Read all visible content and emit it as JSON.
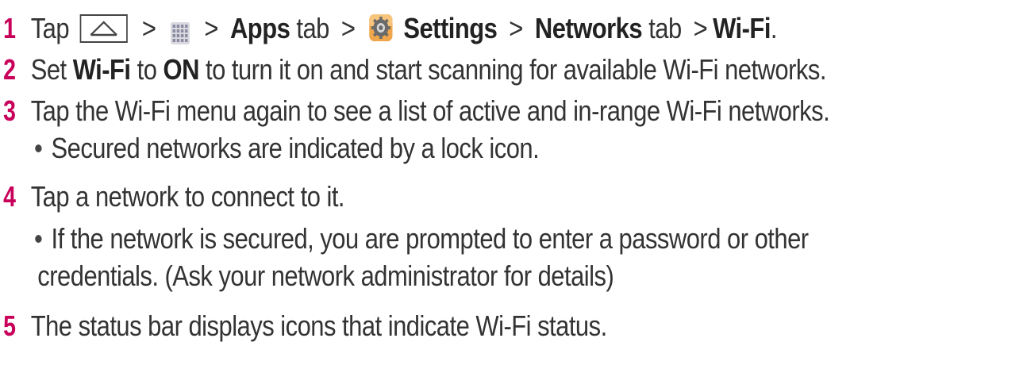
{
  "steps": [
    {
      "number": "1",
      "parts": {
        "tap": "Tap",
        "gt1": ">",
        "gt2": ">",
        "apps": "Apps",
        "tab1": "tab",
        "gt3": ">",
        "settings": "Settings",
        "gt4": ">",
        "networks": "Networks",
        "tab2": "tab",
        "gt5": ">",
        "wifi": "Wi-Fi",
        "end": "."
      },
      "icons": [
        "home-key-icon",
        "apps-grid-icon",
        "settings-gear-icon"
      ]
    },
    {
      "number": "2",
      "parts": {
        "set": "Set",
        "wifi": "Wi-Fi",
        "to": "to",
        "on": "ON",
        "rest": "to turn it on and start scanning for available Wi-Fi networks."
      }
    },
    {
      "number": "3",
      "text": "Tap the Wi-Fi menu again to see a list of active and in-range Wi-Fi networks.",
      "bullets": [
        "Secured networks are indicated by a lock icon."
      ]
    },
    {
      "number": "4",
      "text": "Tap a network to connect to it.",
      "bullets": [
        "If the network is secured, you are prompted to enter a password or other",
        "credentials. (Ask your network administrator for details)"
      ]
    },
    {
      "number": "5",
      "text": "The status bar displays icons that indicate Wi-Fi status."
    }
  ],
  "colors": {
    "step_number": "#c8005a",
    "text": "#333333",
    "bold_text": "#222222"
  }
}
